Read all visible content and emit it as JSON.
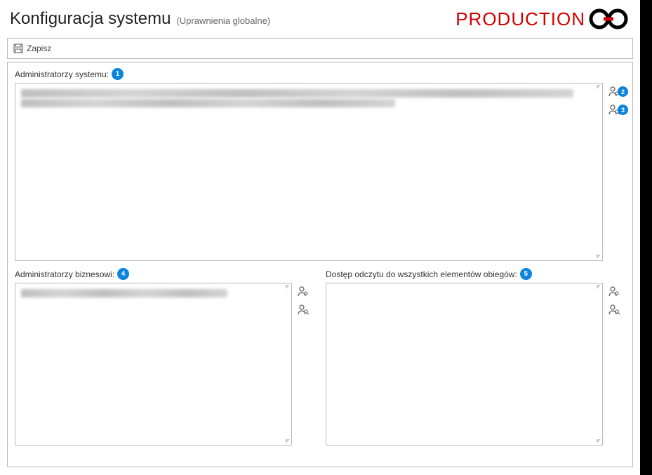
{
  "header": {
    "title": "Konfiguracja systemu",
    "subtitle": "(Uprawnienia globalne)",
    "env_label": "PRODUCTION"
  },
  "toolbar": {
    "save_label": "Zapisz"
  },
  "sections": {
    "sysadmins": {
      "label": "Administratorzy systemu:",
      "badge": "1"
    },
    "bizadmins": {
      "label": "Administratorzy biznesowi:",
      "badge": "4"
    },
    "readall": {
      "label": "Dostęp odczytu do wszystkich elementów obiegów:",
      "badge": "5"
    }
  },
  "side_badges": {
    "top_add": "2",
    "top_search": "3"
  }
}
